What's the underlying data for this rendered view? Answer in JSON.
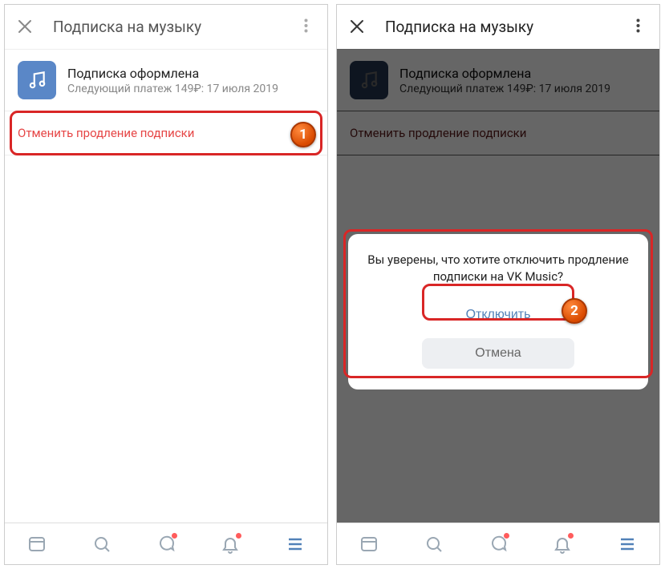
{
  "left": {
    "header_title": "Подписка на музыку",
    "card_title": "Подписка оформлена",
    "card_sub": "Следующий платеж 149₽: 17 июля 2019",
    "cancel_label": "Отменить продление подписки",
    "callout": "1"
  },
  "right": {
    "header_title": "Подписка на музыку",
    "card_title": "Подписка оформлена",
    "card_sub": "Следующий платеж 149₽: 17 июля 2019",
    "cancel_label": "Отменить продление подписки",
    "dialog_msg": "Вы уверены, что хотите отключить продление подписки на VK Music?",
    "dialog_confirm": "Отключить",
    "dialog_cancel": "Отмена",
    "callout": "2"
  }
}
